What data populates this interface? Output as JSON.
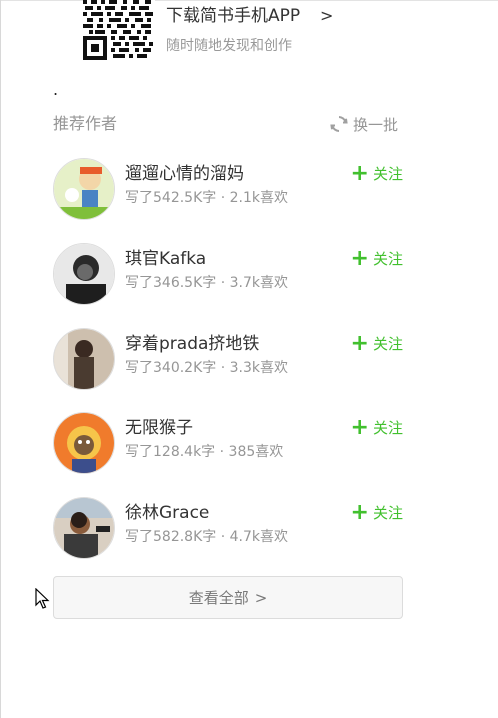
{
  "app_download": {
    "title": "下载简书手机APP",
    "chevron": ">",
    "subtitle": "随时随地发现和创作",
    "qr_icon": "qr-code-icon"
  },
  "dot": ".",
  "recommended": {
    "title": "推荐作者",
    "refresh_label": "换一批",
    "refresh_icon": "refresh-icon",
    "authors": [
      {
        "name": "遛遛心情的溜妈",
        "meta": "写了542.5K字 · 2.1k喜欢",
        "follow_label": "关注",
        "follow_plus": "+"
      },
      {
        "name": "琪官Kafka",
        "meta": "写了346.5K字 · 3.7k喜欢",
        "follow_label": "关注",
        "follow_plus": "+"
      },
      {
        "name": "穿着prada挤地铁",
        "meta": "写了340.2K字 · 3.3k喜欢",
        "follow_label": "关注",
        "follow_plus": "+"
      },
      {
        "name": "无限猴子",
        "meta": "写了128.4k字 · 385喜欢",
        "follow_label": "关注",
        "follow_plus": "+"
      },
      {
        "name": "徐林Grace",
        "meta": "写了582.8K字 · 4.7k喜欢",
        "follow_label": "关注",
        "follow_plus": "+"
      }
    ],
    "view_all_label": "查看全部",
    "view_all_chevron": ">"
  },
  "colors": {
    "follow_green": "#42c02e",
    "muted_text": "#969696",
    "main_text": "#333333"
  }
}
